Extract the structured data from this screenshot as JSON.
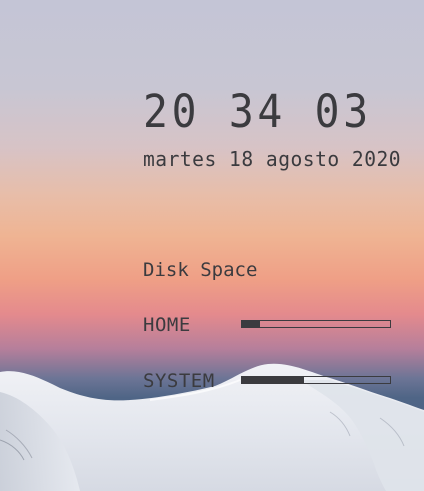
{
  "clock": {
    "time": "20 34 03",
    "date": "martes 18 agosto 2020"
  },
  "disk": {
    "title": "Disk Space",
    "home": {
      "label": "HOME",
      "used_fraction": 0.12
    },
    "system": {
      "label": "SYSTEM",
      "used_fraction": 0.42
    }
  },
  "colors": {
    "text": "#3b3b3f",
    "sky_top": "#c4c5d6",
    "sky_pink": "#ef9f86",
    "sky_blue": "#4f6586",
    "snow": "#e9ecf1"
  }
}
